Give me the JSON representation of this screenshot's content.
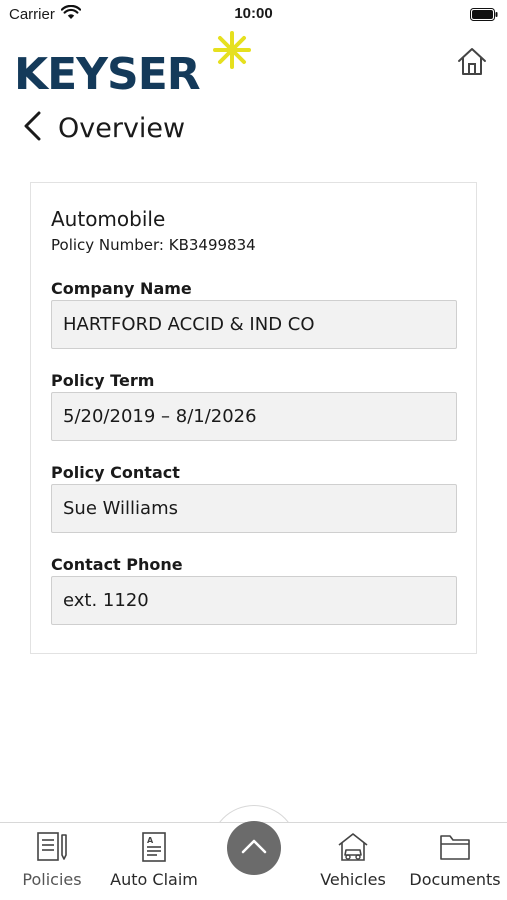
{
  "status_bar": {
    "carrier": "Carrier",
    "time": "10:00",
    "icons": [
      "wifi-icon",
      "battery-icon"
    ]
  },
  "header": {
    "logo_text": "KEYSER",
    "logo_color": "#143a5a",
    "accent_color": "#e6e01e",
    "home_icon": "home-icon"
  },
  "nav": {
    "back_icon": "chevron-left-icon",
    "title": "Overview"
  },
  "policy": {
    "type": "Automobile",
    "policy_number": "Policy Number: KB3499834",
    "fields": [
      {
        "label": "Company Name",
        "value": "HARTFORD ACCID & IND CO"
      },
      {
        "label": "Policy Term",
        "value": "5/20/2019 – 8/1/2026"
      },
      {
        "label": "Policy Contact",
        "value": "Sue Williams"
      },
      {
        "label": "Contact Phone",
        "value": "ext. 1120"
      }
    ]
  },
  "tab_bar": {
    "tabs": [
      {
        "label": "Policies",
        "icon": "policies-icon"
      },
      {
        "label": "Auto Claim",
        "icon": "auto-claim-icon"
      },
      {
        "label": "Vehicles",
        "icon": "vehicles-icon"
      },
      {
        "label": "Documents",
        "icon": "documents-icon"
      }
    ],
    "center_icon": "chevron-up-icon",
    "center_color": "#6b6b6b"
  }
}
